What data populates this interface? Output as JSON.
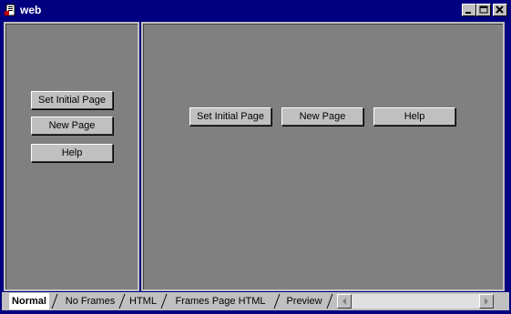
{
  "window": {
    "title": "web",
    "icon": "document-icon"
  },
  "left_frame": {
    "buttons": [
      "Set Initial Page",
      "New Page",
      "Help"
    ]
  },
  "right_frame": {
    "buttons": [
      "Set Initial Page",
      "New Page",
      "Help"
    ]
  },
  "tabs": [
    {
      "label": "Normal",
      "active": true
    },
    {
      "label": "No Frames",
      "active": false
    },
    {
      "label": "HTML",
      "active": false
    },
    {
      "label": "Frames Page HTML",
      "active": false
    },
    {
      "label": "Preview",
      "active": false
    }
  ],
  "colors": {
    "title_bar": "#000080",
    "frame_bg": "#808080",
    "chrome": "#c0c0c0"
  }
}
